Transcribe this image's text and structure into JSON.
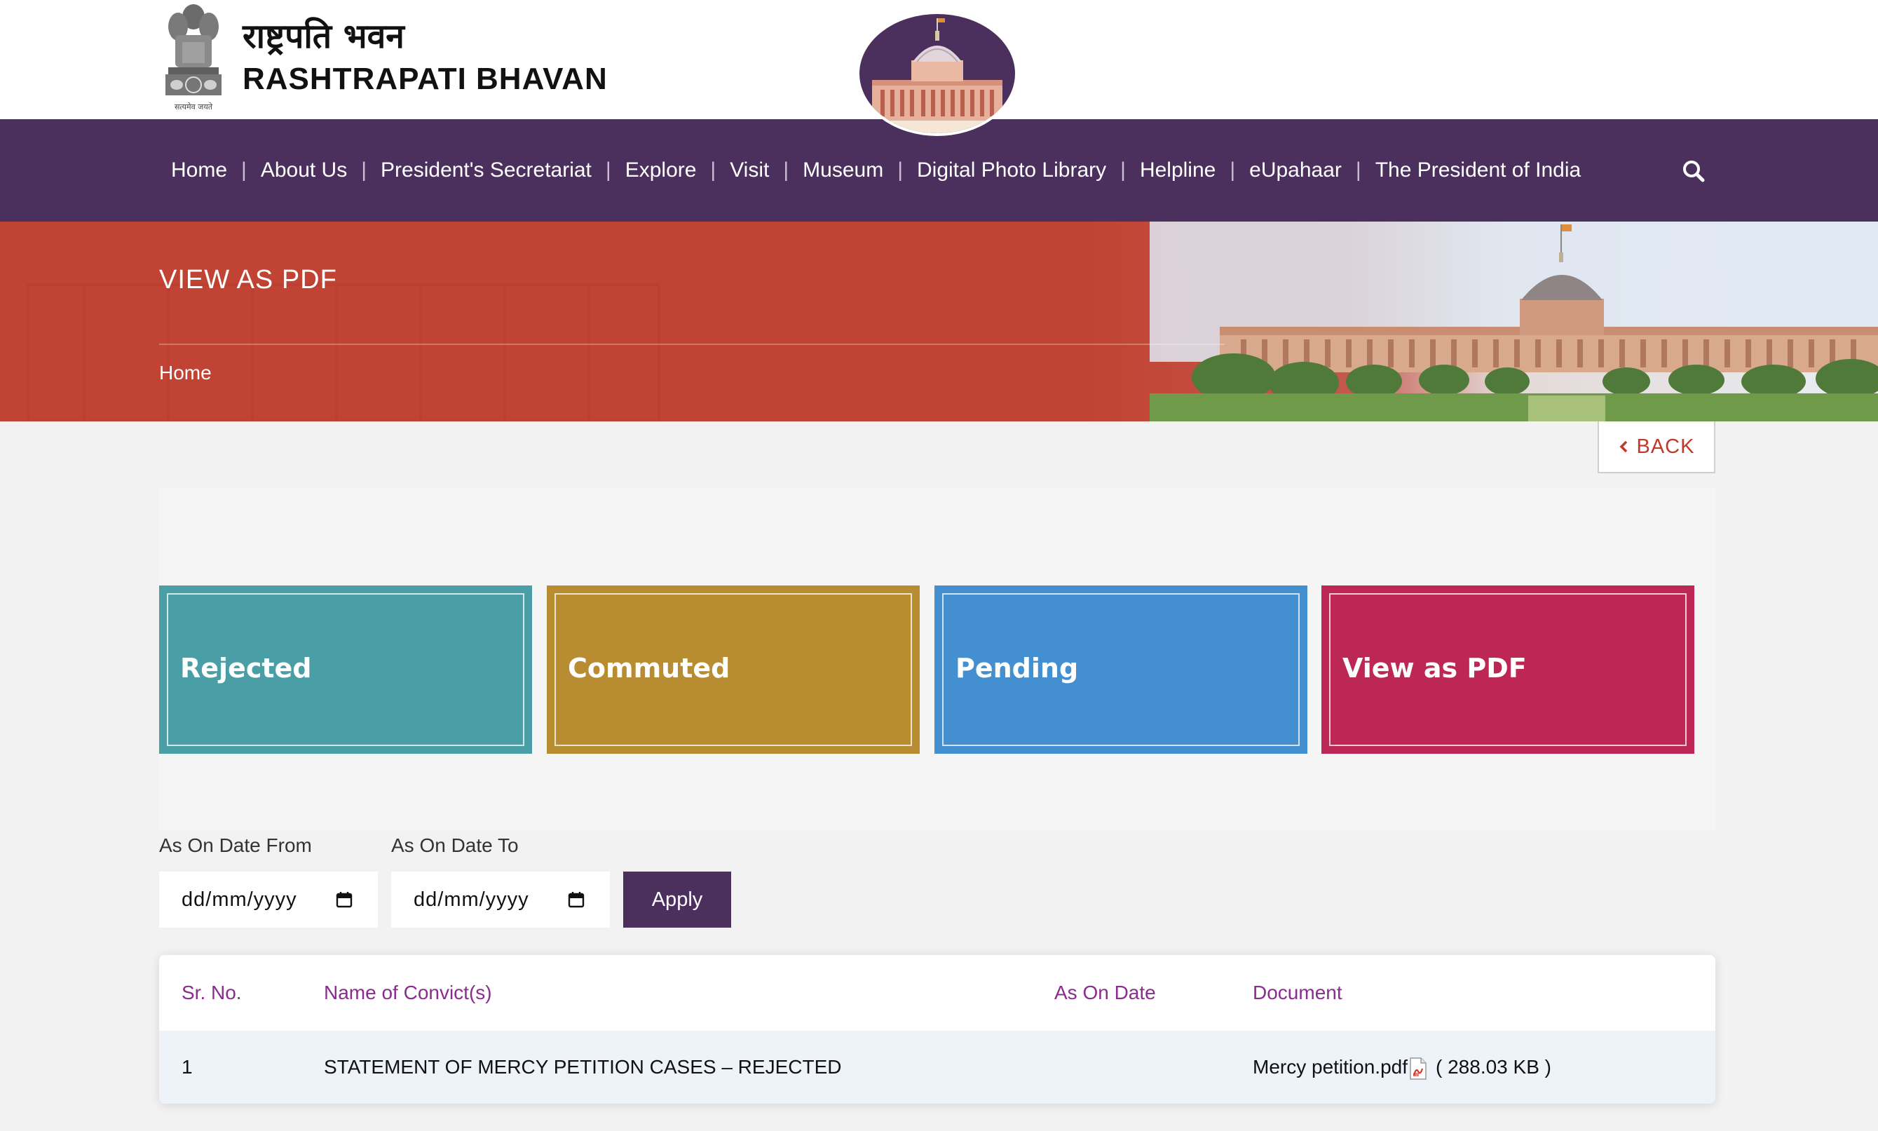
{
  "header": {
    "brand_hindi": "राष्ट्रपति भवन",
    "brand_english": "RASHTRAPATI BHAVAN",
    "emblem_icon": "national-emblem-icon",
    "logo_icon": "rashtrapati-bhavan-dome-logo",
    "emblem_motto": "सत्यमेव जयते"
  },
  "nav": {
    "items": [
      "Home",
      "About Us",
      "President's Secretariat",
      "Explore",
      "Visit",
      "Museum",
      "Digital Photo Library",
      "Helpline",
      "eUpahaar",
      "The President of India"
    ],
    "separator": "|",
    "search_icon": "search-icon"
  },
  "banner": {
    "title": "VIEW AS PDF",
    "breadcrumb": "Home"
  },
  "back_button": {
    "label": "BACK",
    "icon": "chevron-left-icon"
  },
  "tiles": [
    {
      "label": "Rejected",
      "color": "#4a9ea6"
    },
    {
      "label": "Commuted",
      "color": "#b88c30"
    },
    {
      "label": "Pending",
      "color": "#438fd0"
    },
    {
      "label": "View as PDF",
      "color": "#bd2756"
    }
  ],
  "filter": {
    "from_label": "As On Date From",
    "to_label": "As On Date To",
    "from_value": "dd/mm/yyyy",
    "to_value": "dd/mm/yyyy",
    "apply_label": "Apply"
  },
  "table": {
    "columns": [
      "Sr. No.",
      "Name of Convict(s)",
      "As On Date",
      "Document"
    ],
    "rows": [
      {
        "sr": "1",
        "name": "STATEMENT OF MERCY PETITION CASES – REJECTED",
        "date": "",
        "document": "Mercy petition.pdf",
        "size": "( 288.03 KB )"
      }
    ]
  },
  "colors": {
    "nav_bg": "#4b2f5c",
    "banner_red": "#c14333",
    "header_text": "#8a2d8e",
    "back_text": "#c0392b"
  }
}
